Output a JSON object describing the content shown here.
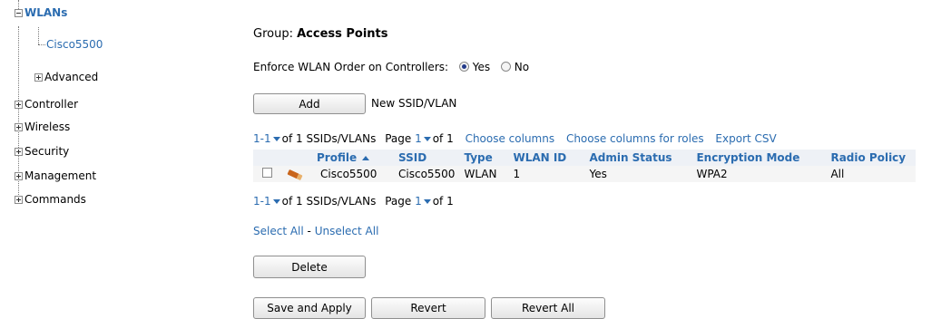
{
  "sidebar": {
    "wlans": "WLANs",
    "cisco5500": "Cisco5500",
    "advanced": "Advanced",
    "controller": "Controller",
    "wireless": "Wireless",
    "security": "Security",
    "management": "Management",
    "commands": "Commands"
  },
  "main": {
    "group_prefix": "Group: ",
    "group_name": "Access Points",
    "enforce_label": "Enforce WLAN Order on Controllers:",
    "enforce_yes": "Yes",
    "enforce_no": "No",
    "enforce_selected": "Yes",
    "add_button": "Add",
    "new_ssid_label": "New SSID/VLAN",
    "pager_top": {
      "range": "1-1",
      "of_text": "of 1 SSIDs/VLANs",
      "page_label": "Page",
      "page": "1",
      "page_of": "of 1",
      "choose_columns": "Choose columns",
      "choose_columns_roles": "Choose columns for roles",
      "export_csv": "Export CSV"
    },
    "table": {
      "headers": [
        "Profile",
        "SSID",
        "Type",
        "WLAN ID",
        "Admin Status",
        "Encryption Mode",
        "Radio Policy"
      ],
      "rows": [
        [
          "Cisco5500",
          "Cisco5500",
          "WLAN",
          "1",
          "Yes",
          "WPA2",
          "All"
        ]
      ]
    },
    "pager_bottom": {
      "range": "1-1",
      "of_text": "of 1 SSIDs/VLANs",
      "page_label": "Page",
      "page": "1",
      "page_of": "of 1"
    },
    "select_all": "Select All",
    "separator": " - ",
    "unselect_all": "Unselect All",
    "delete_button": "Delete",
    "save_apply_button": "Save and Apply",
    "revert_button": "Revert",
    "revert_all_button": "Revert All"
  },
  "colors": {
    "link": "#2b6cb0",
    "header_bg": "#eef1f6",
    "row_bg": "#f5f5f5"
  }
}
